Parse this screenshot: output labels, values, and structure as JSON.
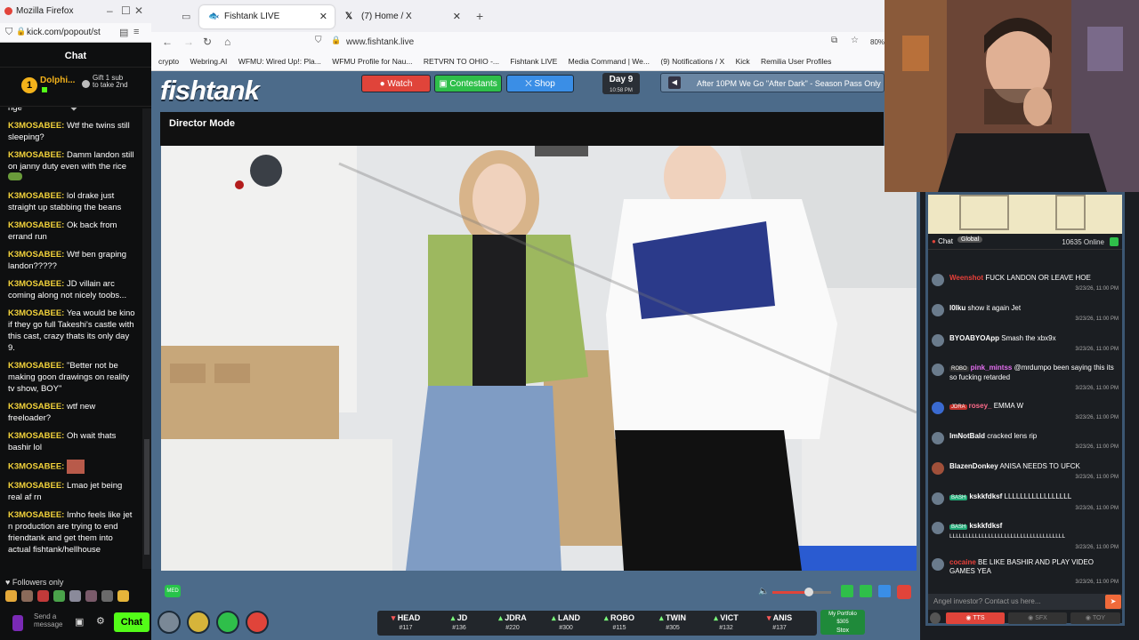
{
  "left_window": {
    "title": "Mozilla Firefox",
    "url": "kick.com/popout/st",
    "chat_header": "Chat",
    "pinned": {
      "rank": "1",
      "user": "Dolphi...",
      "gift": "Gift 1 sub to take 2nd"
    },
    "messages": [
      {
        "user": "",
        "text": "nge"
      },
      {
        "user": "K3MOSABEE:",
        "text": "Wtf the twins still sleeping?"
      },
      {
        "user": "K3MOSABEE:",
        "text": "Damm landon still on janny duty even with the rice"
      },
      {
        "user": "K3MOSABEE:",
        "text": "lol drake just straight up stabbing the beans"
      },
      {
        "user": "K3MOSABEE:",
        "text": "Ok back from errand run"
      },
      {
        "user": "K3MOSABEE:",
        "text": "Wtf ben graping landon?????"
      },
      {
        "user": "K3MOSABEE:",
        "text": "JD villain arc coming along not nicely toobs..."
      },
      {
        "user": "K3MOSABEE:",
        "text": "Yea would be kino if they go full Takeshi's castle with this cast, crazy thats its only day 9."
      },
      {
        "user": "K3MOSABEE:",
        "text": "\"Better not be making goon drawings on reality tv show, BOY\""
      },
      {
        "user": "K3MOSABEE:",
        "text": "wtf new freeloader?"
      },
      {
        "user": "K3MOSABEE:",
        "text": "Oh wait thats bashir lol"
      },
      {
        "user": "K3MOSABEE:",
        "text": ""
      },
      {
        "user": "K3MOSABEE:",
        "text": "Lmao jet being real af rn"
      },
      {
        "user": "K3MOSABEE:",
        "text": "Imho feels like jet n production are trying to end friendtank and get them into actual fishtank/hellhouse"
      }
    ],
    "followers_only": "Followers only",
    "send_placeholder": "Send a message",
    "chat_button": "Chat"
  },
  "browser": {
    "tabs": [
      {
        "label": "Fishtank LIVE"
      },
      {
        "label": "(7) Home / X"
      }
    ],
    "url": "www.fishtank.live",
    "zoom": "80%",
    "bookmarks": [
      "crypto",
      "Webring.AI",
      "WFMU: Wired Up!: Pla...",
      "WFMU Profile for Nau...",
      "RETVRN TO OHIO -...",
      "Fishtank LIVE",
      "Media Command | We...",
      "(9) Notifications / X",
      "Kick",
      "Remilia User Profiles"
    ]
  },
  "site": {
    "logo": "fishtank",
    "nav": {
      "watch": "Watch",
      "contestants": "Contestants",
      "shop": "Shop"
    },
    "day": "Day 9",
    "time": "10:58 PM",
    "ticker": "After 10PM We Go \"After Dark\" - Season Pass Only",
    "director_mode": "Director Mode",
    "quality": "MED",
    "cams": [
      {
        "name": "HEAD",
        "id": "#117",
        "color": "#ff5a5a"
      },
      {
        "name": "JD",
        "id": "#136",
        "color": "#7cff7c"
      },
      {
        "name": "JDRA",
        "id": "#220",
        "color": "#7cff7c"
      },
      {
        "name": "LAND",
        "id": "#300",
        "color": "#7cff7c"
      },
      {
        "name": "ROBO",
        "id": "#115",
        "color": "#7cff7c"
      },
      {
        "name": "TWIN",
        "id": "#305",
        "color": "#7cff7c"
      },
      {
        "name": "VICT",
        "id": "#132",
        "color": "#7cff7c"
      },
      {
        "name": "ANIS",
        "id": "#137",
        "color": "#ff5a5a"
      }
    ],
    "portfolio": {
      "title": "My Portfolio",
      "value": "$305",
      "label": "Stox"
    }
  },
  "site_chat": {
    "tab": "Chat",
    "global": "Global",
    "online": "10635 Online",
    "messages": [
      {
        "user": "Weenshot",
        "text": "FUCK LANDON OR LEAVE HOE",
        "time": "3/23/26, 11:00 PM",
        "color": "#e8403a",
        "badge": ""
      },
      {
        "user": "l0lku",
        "text": "show it again Jet",
        "time": "3/23/26, 11:00 PM",
        "color": "#ffffff",
        "badge": ""
      },
      {
        "user": "BYOABYOApp",
        "text": "Smash the xbx9x",
        "time": "3/23/26, 11:00 PM",
        "color": "#ffffff",
        "badge": ""
      },
      {
        "user": "pink_mintss",
        "text": "@mrdumpo been saying this its so fucking retarded",
        "time": "3/23/26, 11:00 PM",
        "color": "#e46ef0",
        "badge": "ROBO"
      },
      {
        "user": "rosey_",
        "text": "EMMA W",
        "time": "3/23/26, 11:00 PM",
        "color": "#ff6a8a",
        "badge": "JDRA"
      },
      {
        "user": "ImNotBald",
        "text": "cracked lens rip",
        "time": "3/23/26, 11:00 PM",
        "color": "#ffffff",
        "badge": ""
      },
      {
        "user": "BlazenDonkey",
        "text": "ANISA NEEDS TO UFCK",
        "time": "3/23/26, 11:00 PM",
        "color": "#ffffff",
        "badge": ""
      },
      {
        "user": "kskkfdksf",
        "text": "LLLLLLLLLLLLLLLLL",
        "time": "3/23/26, 11:00 PM",
        "color": "#ffffff",
        "badge": "BASH"
      },
      {
        "user": "kskkfdksf",
        "text": "LLLLLLLLLLLLLLLLLLLLLLLLLLLLLLLLLLLL",
        "time": "3/23/26, 11:00 PM",
        "color": "#ffffff",
        "badge": "BASH"
      },
      {
        "user": "cocaine",
        "text": "BE LIKE BASHIR AND PLAY VIDEO GAMES YEA",
        "time": "3/23/26, 11:00 PM",
        "color": "#e8403a",
        "badge": ""
      }
    ],
    "input_placeholder": "Angel investor? Contact us here...",
    "buttons": {
      "tts": "TTS",
      "sfx": "SFX",
      "toy": "TOY"
    }
  }
}
